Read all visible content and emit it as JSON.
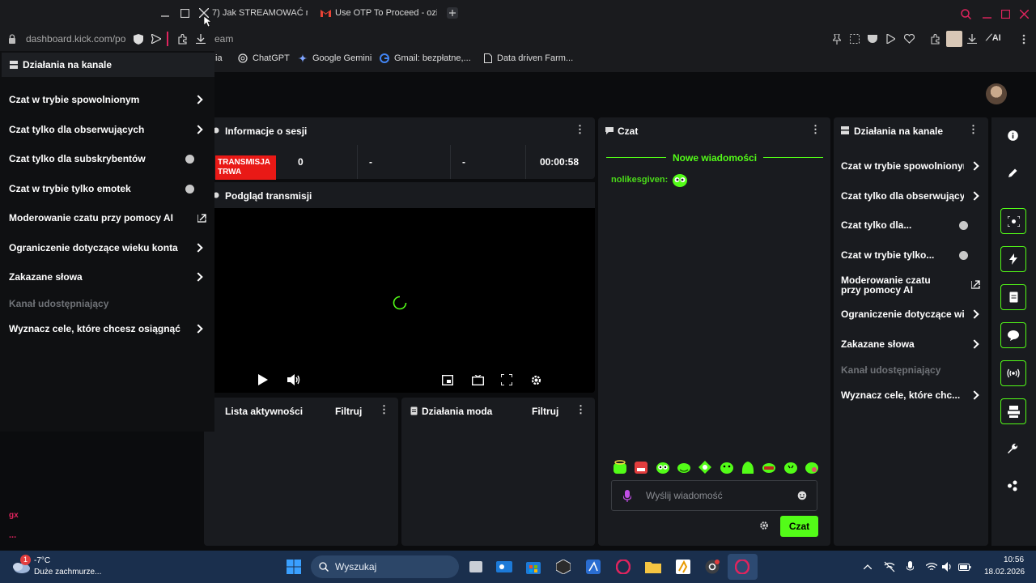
{
  "browser": {
    "tabs": [
      {
        "label": "7) Jak STREAMOWAĆ n"
      },
      {
        "label": "Use OTP To Proceed - ozi"
      }
    ],
    "url": "dashboard.kick.com/po",
    "url_tail": "eam",
    "ai_label": "AI",
    "bookmarks": [
      {
        "label": "ia"
      },
      {
        "label": "ChatGPT"
      },
      {
        "label": "Google Gemini"
      },
      {
        "label": "Gmail: bezpłatne,..."
      },
      {
        "label": "Data driven Farm..."
      }
    ]
  },
  "left_overlay": {
    "title": "Działania na kanale",
    "items": [
      {
        "label": "Czat w trybie spowolnionym",
        "control": "chevron"
      },
      {
        "label": "Czat tylko dla obserwujących",
        "control": "chevron"
      },
      {
        "label": "Czat tylko dla subskrybentów",
        "control": "toggle"
      },
      {
        "label": "Czat w trybie tylko emotek",
        "control": "toggle"
      },
      {
        "label": "Moderowanie czatu przy pomocy AI",
        "control": "external"
      },
      {
        "label": "Ograniczenie dotyczące wieku konta",
        "control": "chevron"
      },
      {
        "label": "Zakazane słowa",
        "control": "chevron"
      }
    ],
    "section_label": "Kanał udostępniający",
    "goals_label": "Wyznacz cele, które chcesz osiągnąć",
    "bottom_tag": "gx",
    "dots": "..."
  },
  "session": {
    "title": "Informacje o sesji",
    "status": "TRANSMISJA TRWA",
    "cells": [
      "0",
      "-",
      "-",
      "00:00:58"
    ]
  },
  "preview": {
    "title": "Podgląd transmisji"
  },
  "activity": {
    "title": "Lista aktywności",
    "filter": "Filtruj"
  },
  "mod_actions": {
    "title": "Działania moda",
    "filter": "Filtruj"
  },
  "chat": {
    "title": "Czat",
    "new_messages": "Nowe wiadomości",
    "messages": [
      {
        "user": "nolikesgiven:"
      }
    ],
    "input_placeholder": "Wyślij wiadomość",
    "send_label": "Czat"
  },
  "channel_actions": {
    "title": "Działania na kanale",
    "items": [
      {
        "label": "Czat w trybie spowolnionym",
        "control": "chevron"
      },
      {
        "label": "Czat tylko dla obserwujących",
        "control": "chevron"
      },
      {
        "label": "Czat tylko dla...",
        "control": "toggle"
      },
      {
        "label": "Czat w trybie tylko...",
        "control": "toggle"
      },
      {
        "label": "Moderowanie czatu przy pomocy AI",
        "control": "external"
      },
      {
        "label": "Ograniczenie dotyczące wieku",
        "control": "chevron"
      },
      {
        "label": "Zakazane słowa",
        "control": "chevron"
      }
    ],
    "section_label": "Kanał udostępniający",
    "goals_label": "Wyznacz cele, które chc..."
  },
  "taskbar": {
    "weather_temp": "-7°C",
    "weather_desc": "Duże zachmurze...",
    "weather_badge": "1",
    "search_label": "Wyszukaj",
    "time": "10:56",
    "date": "18.02.2026"
  },
  "colors": {
    "accent": "#53fc18",
    "live": "#e91916",
    "taskbar": "#1a2f4d"
  }
}
